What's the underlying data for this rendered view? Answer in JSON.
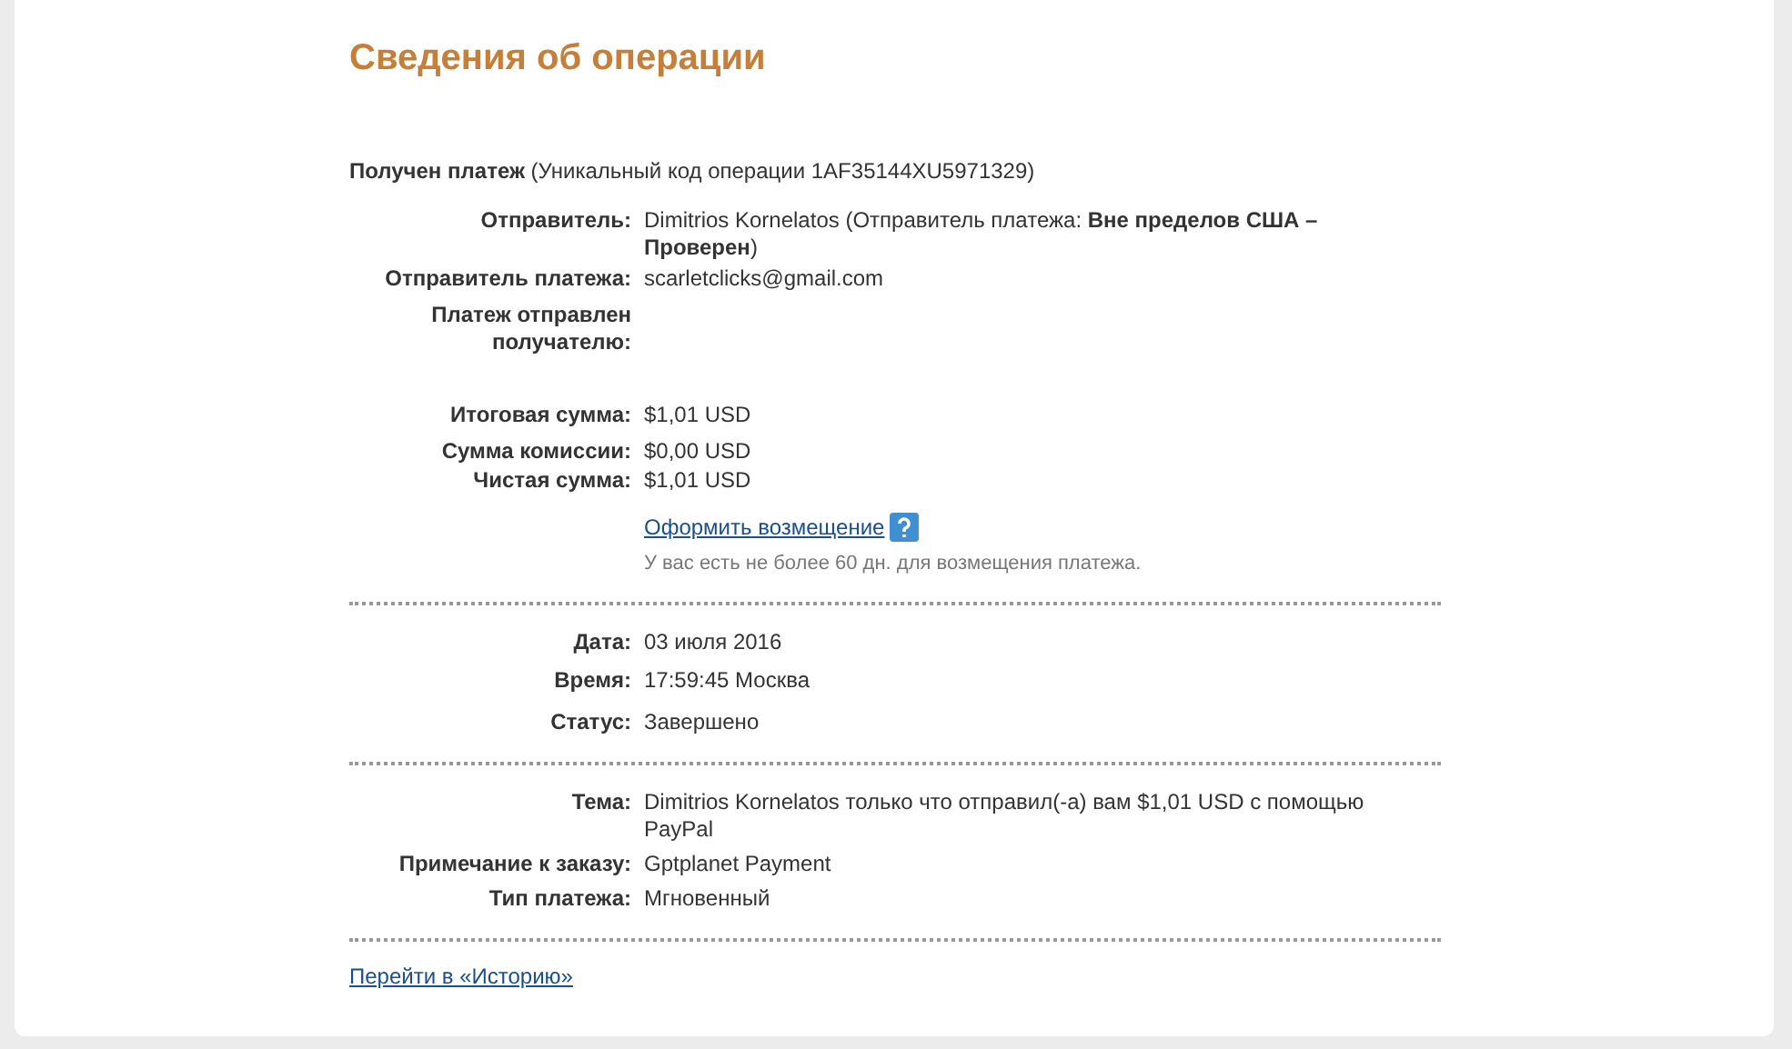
{
  "title": "Сведения об операции",
  "header": "**Получен платеж** (Уникальный код операции 1AF35144XU5971329)",
  "sections": [
    {
      "groups": [
        [
          {
            "label": "Отправитель:",
            "value": "Dimitrios Kornelatos (Отправитель платежа: **Вне пределов США – Проверен**)"
          },
          {
            "label": "Отправитель платежа:",
            "value": "scarletclicks@gmail.com"
          },
          {
            "label": "Платеж отправлен получателю:"
          }
        ],
        [
          {
            "label": "Итоговая сумма:",
            "value": "$1,01 USD"
          }
        ],
        [
          {
            "label": "Сумма комиссии:",
            "value": "$0,00 USD"
          },
          {
            "label": "Чистая сумма:",
            "value": "$1,01 USD"
          }
        ]
      ],
      "refund_link": "Оформить возмещение",
      "refund_note": "У вас есть не более 60 дн. для возмещения платежа."
    },
    {
      "groups": [
        [
          {
            "label": "Дата:",
            "value": "03 июля 2016"
          },
          {
            "label": "Время:",
            "value": "17:59:45 Москва"
          }
        ],
        [
          {
            "label": "Статус:",
            "value": "Завершено"
          }
        ]
      ]
    },
    {
      "groups": [
        [
          {
            "label": "Тема:",
            "value": "Dimitrios Kornelatos только что отправил(-а) вам $1,01 USD с помощью PayPal"
          },
          {
            "label": "Примечание к заказу:",
            "value": "Gptplanet Payment"
          },
          {
            "label": "Тип платежа:",
            "value": "Мгновенный"
          }
        ]
      ]
    }
  ],
  "history_link": "Перейти в «Историю»"
}
